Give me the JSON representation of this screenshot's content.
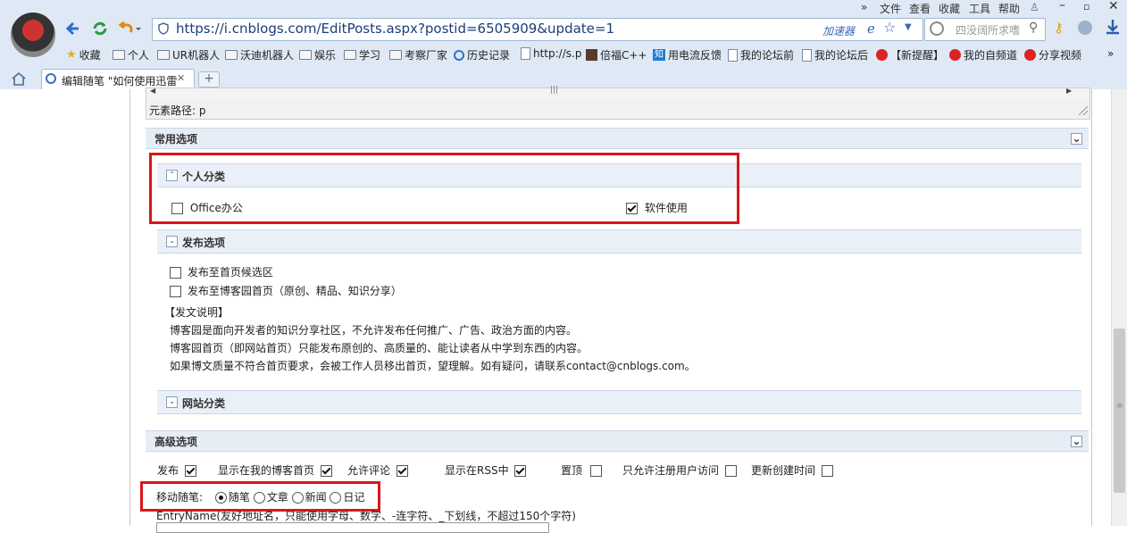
{
  "browser": {
    "menu": [
      "文件",
      "查看",
      "收藏",
      "工具",
      "帮助"
    ],
    "url": "https://i.cnblogs.com/EditPosts.aspx?postid=6505909&update=1",
    "accelerator": "加速器",
    "search_placeholder": "四没阔所求嗜",
    "bookmarks": [
      "收藏",
      "个人",
      "UR机器人",
      "沃迪机器人",
      "娱乐",
      "学习",
      "考察厂家",
      "历史记录",
      "http://s.p",
      "倍福C++",
      "用电流反馈",
      "我的论坛前",
      "我的论坛后",
      "【新提醒】",
      "我的自频道",
      "分享视频"
    ],
    "zhi_badge": "知",
    "tab_title": "编辑随笔 \"如何使用迅雷",
    "accent": "#3470c8"
  },
  "editor": {
    "element_path": "元素路径: p"
  },
  "common_options": {
    "title": "常用选项",
    "category": {
      "title": "个人分类",
      "items": [
        {
          "label": "Office办公",
          "checked": false
        },
        {
          "label": "软件使用",
          "checked": true
        }
      ]
    },
    "publish": {
      "title": "发布选项",
      "items": [
        {
          "label": "发布至首页候选区",
          "checked": false
        },
        {
          "label": "发布至博客园首页（原创、精品、知识分享）",
          "checked": false
        }
      ],
      "note_title": "【发文说明】",
      "notes": [
        "博客园是面向开发者的知识分享社区，不允许发布任何推广、广告、政治方面的内容。",
        "博客园首页（即网站首页）只能发布原创的、高质量的、能让读者从中学到东西的内容。",
        "如果博文质量不符合首页要求，会被工作人员移出首页，望理解。如有疑问，请联系contact@cnblogs.com。"
      ]
    },
    "site_category": {
      "title": "网站分类"
    }
  },
  "advanced_options": {
    "title": "高级选项",
    "checks": [
      {
        "label": "发布",
        "checked": true
      },
      {
        "label": "显示在我的博客首页",
        "checked": true
      },
      {
        "label": "允许评论",
        "checked": true
      },
      {
        "label": "显示在RSS中",
        "checked": true
      },
      {
        "label": "置顶",
        "checked": false
      },
      {
        "label": "只允许注册用户访问",
        "checked": false
      },
      {
        "label": "更新创建时间",
        "checked": false
      }
    ],
    "move_label": "移动随笔:",
    "move_options": [
      {
        "label": "随笔",
        "selected": true
      },
      {
        "label": "文章",
        "selected": false
      },
      {
        "label": "新闻",
        "selected": false
      },
      {
        "label": "日记",
        "selected": false
      }
    ],
    "entry_name_label": "EntryName(友好地址名，只能使用字母、数字、-连字符、_下划线，不超过150个字符)"
  },
  "highlight_color": "#d8171b"
}
